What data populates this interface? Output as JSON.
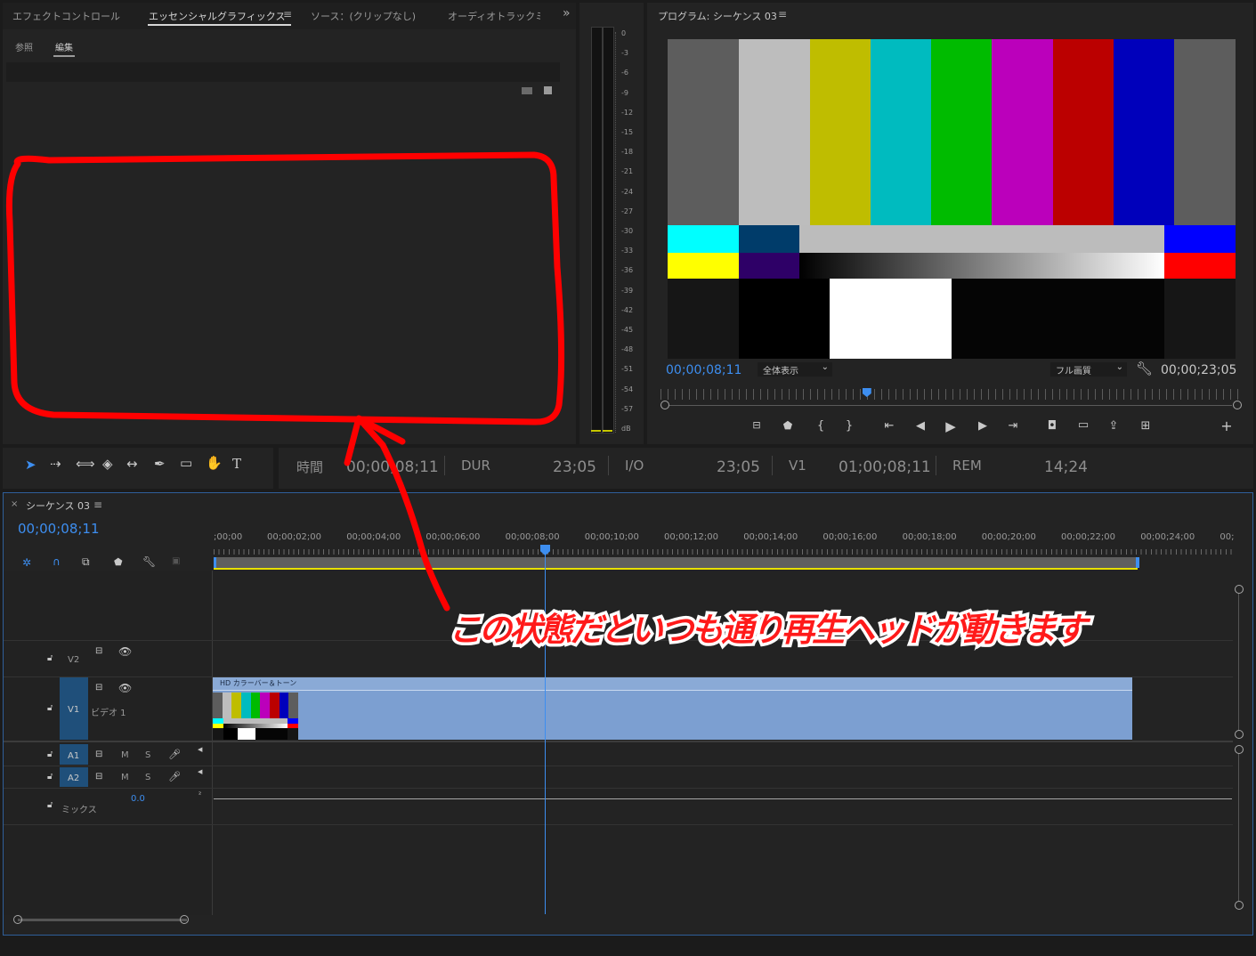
{
  "effects_panel": {
    "tabs": [
      "エフェクトコントロール",
      "エッセンシャルグラフィックス",
      "ソース：(クリップなし)",
      "オーディオトラックミ"
    ],
    "active_tab_menu": "≡",
    "overflow": "»",
    "subtabs": [
      "参照",
      "編集"
    ]
  },
  "audio_meter": {
    "labels": [
      "0",
      "-3",
      "-6",
      "-9",
      "-12",
      "-15",
      "-18",
      "-21",
      "-24",
      "-27",
      "-30",
      "-33",
      "-36",
      "-39",
      "-42",
      "-45",
      "-48",
      "-51",
      "-54",
      "-57",
      "dB"
    ]
  },
  "program_monitor": {
    "title": "プログラム: シーケンス 03",
    "menu": "≡",
    "timecode_current": "00;00;08;11",
    "zoom_select": "全体表示",
    "quality_select": "フル画質",
    "timecode_duration": "00;00;23;05",
    "playhead_fraction": 0.355,
    "colors_top": [
      "#5d5d5d",
      "#bdbdbd",
      "#bfbd00",
      "#00bbbf",
      "#00bb00",
      "#bb00bb",
      "#bb0000",
      "#0000bb",
      "#5d5d5d"
    ],
    "colors_mid_left": [
      "#00ffff",
      "#003c6a"
    ],
    "colors_mid_right": [
      "#0000ff"
    ],
    "colors_low_left": [
      "#ffff00",
      "#2e0067"
    ],
    "colors_low_right": [
      "#ff0000"
    ],
    "buttons": [
      "marker-add",
      "mark-in",
      "mark-out",
      "go-to-in",
      "step-back",
      "play",
      "step-forward",
      "go-to-out",
      "export-frame",
      "safe-margins",
      "insert",
      "compare",
      "add"
    ]
  },
  "info_bar": {
    "time_label": "時間",
    "time_value": "00;00;08;11",
    "dur_label": "DUR",
    "dur_value": "23;05",
    "io_label": "I/O",
    "io_value": "23;05",
    "v1_label": "V1",
    "v1_value": "01;00;08;11",
    "rem_label": "REM",
    "rem_value": "14;24"
  },
  "timeline": {
    "close": "×",
    "title": "シーケンス 03",
    "menu": "≡",
    "timecode": "00;00;08;11",
    "ruler": [
      ";00;00",
      "00;00;02;00",
      "00;00;04;00",
      "00;00;06;00",
      "00;00;08;00",
      "00;00;10;00",
      "00;00;12;00",
      "00;00;14;00",
      "00;00;16;00",
      "00;00;18;00",
      "00;00;20;00",
      "00;00;22;00",
      "00;00;24;00",
      "00;"
    ],
    "tracks": {
      "v2": "V2",
      "v1": "V1",
      "v1_name": "ビデオ 1",
      "a1": "A1",
      "a2": "A2",
      "mix": "ミックス",
      "mix_value": "0.0",
      "m": "M",
      "s": "S"
    },
    "clip_name": "HD カラーバー＆トーン"
  },
  "annotation": {
    "caption": "この状態だといつも通り再生ヘッドが動きます",
    "highlight_color": "#ff0000"
  }
}
